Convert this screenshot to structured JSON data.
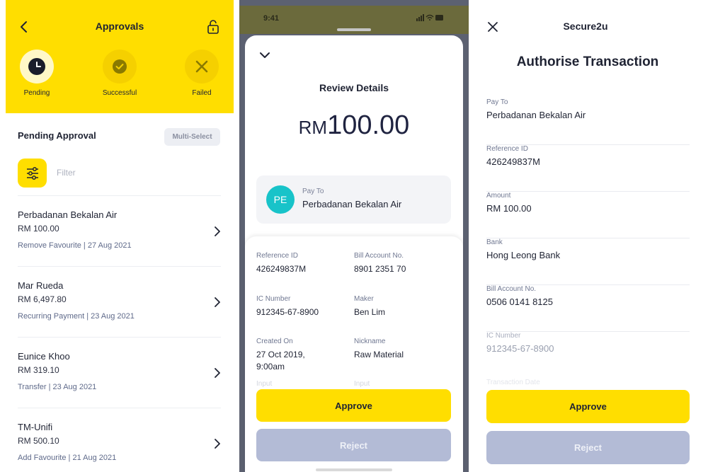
{
  "screen1": {
    "title": "Approvals",
    "statuses": [
      {
        "label": "Pending"
      },
      {
        "label": "Successful"
      },
      {
        "label": "Failed"
      }
    ],
    "section_title": "Pending Approval",
    "multi_select_label": "Multi-Select",
    "filter_label": "Filter",
    "items": [
      {
        "name": "Perbadanan Bekalan Air",
        "amount": "RM 100.00",
        "meta": "Remove Favourite | 27 Aug 2021"
      },
      {
        "name": "Mar Rueda",
        "amount": "RM 6,497.80",
        "meta": "Recurring Payment | 23 Aug 2021"
      },
      {
        "name": "Eunice Khoo",
        "amount": "RM 319.10",
        "meta": "Transfer | 23 Aug 2021"
      },
      {
        "name": "TM-Unifi",
        "amount": "RM 500.10",
        "meta": "Add Favourite | 21 Aug 2021"
      }
    ],
    "colors": {
      "brand_yellow": "#ffde00",
      "meta_text": "#5f6a8a"
    }
  },
  "screen2": {
    "time": "9:41",
    "title": "Review Details",
    "currency": "RM",
    "amount": "100.00",
    "avatar_initials": "PE",
    "pay_to_label": "Pay To",
    "pay_to_value": "Perbadanan Bekalan Air",
    "fields": [
      {
        "label": "Reference ID",
        "value": "426249837M"
      },
      {
        "label": "Bill Account No.",
        "value": "8901 2351 70"
      },
      {
        "label": "IC Number",
        "value": "912345-67-8900"
      },
      {
        "label": "Maker",
        "value": "Ben Lim"
      },
      {
        "label": "Created On",
        "value": "27 Oct 2019,\n9:00am"
      },
      {
        "label": "Nickname",
        "value": "Raw Material"
      },
      {
        "label": "Input"
      },
      {
        "label": "Input"
      }
    ],
    "approve_label": "Approve",
    "reject_label": "Reject"
  },
  "screen3": {
    "title": "Secure2u",
    "heading": "Authorise Transaction",
    "fields": [
      {
        "label": "Pay To",
        "value": "Perbadanan Bekalan Air"
      },
      {
        "label": "Reference ID",
        "value": "426249837M"
      },
      {
        "label": "Amount",
        "value": "RM 100.00"
      },
      {
        "label": "Bank",
        "value": "Hong Leong Bank"
      },
      {
        "label": "Bill Account No.",
        "value": "0506 0141 8125"
      },
      {
        "label": "IC Number",
        "value": "912345-67-8900"
      },
      {
        "label": "Transaction Date"
      }
    ],
    "approve_label": "Approve",
    "reject_label": "Reject",
    "colors": {
      "approve": "#ffde00",
      "reject": "#b3bbd6"
    }
  }
}
